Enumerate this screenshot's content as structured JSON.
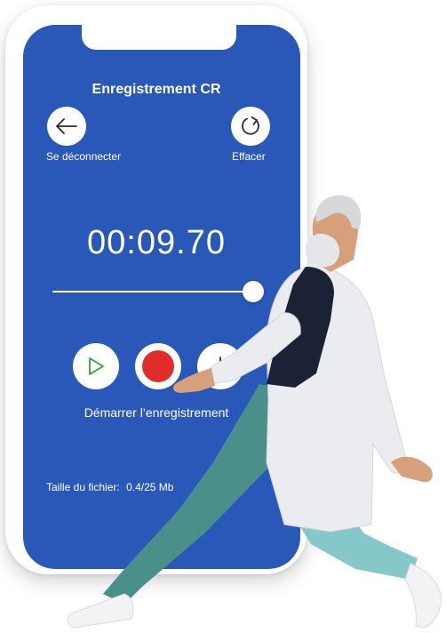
{
  "header": {
    "title": "Enregistrement CR"
  },
  "actions": {
    "logout_label": "Se déconnecter",
    "clear_label": "Effacer"
  },
  "recorder": {
    "timer": "00:09.70",
    "progress": 1.0,
    "start_label": "Démarrer l’enregistrement",
    "file_size_label": "Taille du fichier:",
    "file_size_value": "0.4/25 Mb"
  },
  "icons": {
    "back": "arrow-left-icon",
    "clear": "refresh-icon",
    "play": "play-icon",
    "record": "record-icon",
    "stop": "stop-icon"
  },
  "colors": {
    "screen_bg": "#2a58b8",
    "record_red": "#e22c2c",
    "play_green": "#36a23c",
    "coat": "#ebecef",
    "pants": "#4a8f8a",
    "pants_light": "#86c7ca",
    "shirt": "#1c2236",
    "skin": "#d7a07a"
  }
}
